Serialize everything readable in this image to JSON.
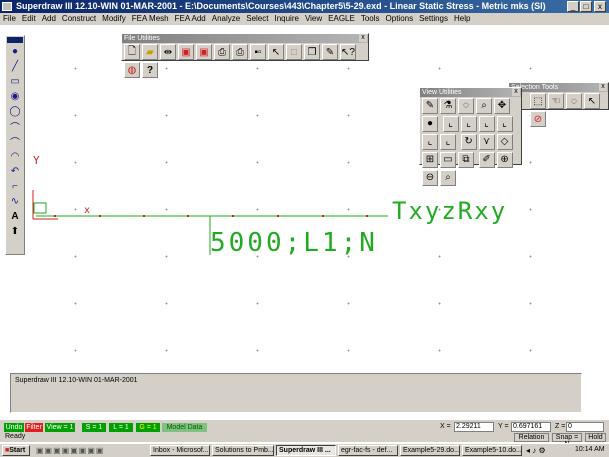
{
  "window": {
    "title": "Superdraw III 12.10-WIN 01-MAR-2001 - E:\\Documents\\Courses\\443\\Chapter5\\5-29.exd - Linear Static Stress - Metric mks (SI)",
    "minimize": "_",
    "maximize": "□",
    "close": "x"
  },
  "menu": [
    "File",
    "Edit",
    "Add",
    "Construct",
    "Modify",
    "FEA Mesh",
    "FEA Add",
    "Analyze",
    "Select",
    "Inquire",
    "View",
    "EAGLE",
    "Tools",
    "Options",
    "Settings",
    "Help"
  ],
  "palettes": {
    "file_utilities": {
      "title": "File Utilities",
      "close": "x",
      "icons": [
        "new-icon",
        "open-icon",
        "merge-icon",
        "save-icon",
        "save-as-icon",
        "print-icon",
        "plot-icon",
        "pointer-icon",
        "blank-icon",
        "copy-icon",
        "pen-icon",
        "help-select-icon",
        "snapshot-icon",
        "help-icon"
      ]
    },
    "view_utilities": {
      "title": "View Utilities",
      "close": "x",
      "icons": [
        "pen-icon",
        "flask-icon",
        "dash-circle-icon",
        "zoom-icon",
        "pan-icon",
        "sphere-icon",
        "view-xy-icon",
        "view-yz-icon",
        "view-xz-icon",
        "view-iso-icon",
        "view-top-icon",
        "view-side-icon",
        "rotate-icon",
        "axis-icon",
        "perspective-icon",
        "dynamic-icon",
        "fit-icon",
        "cube-icon",
        "pencil-icon",
        "zoom-in-icon",
        "zoom-out-icon",
        "zoom-window-icon"
      ]
    },
    "selection_tools": {
      "title": "Selection Tools",
      "close": "x",
      "icons": [
        "select-box-icon",
        "select-hand-icon",
        "select-lasso-icon",
        "select-pointer-icon",
        "deselect-icon"
      ]
    }
  },
  "canvas": {
    "axis_label": "Y",
    "right_label": "TxyzRxy",
    "load_label": "5000;L1;N",
    "x_marker": "x"
  },
  "command_area": {
    "text": "Superdraw III 12.10-WIN 01-MAR-2001"
  },
  "status": {
    "buttons": [
      "Undo",
      "Filter",
      "View = 1",
      "S = 1",
      "L = 1",
      "G = 1",
      "Model Data"
    ],
    "button_colors": [
      "#00a000",
      "#e02020",
      "#00a000",
      "#00a000",
      "#00a000",
      "#00a000",
      "#00a000"
    ],
    "x_label": "X =",
    "x_value": "2.29211",
    "y_label": "Y =",
    "y_value": "0.697161",
    "z_label": "Z =",
    "z_value": "0",
    "ready": "Ready",
    "relation": "Relation",
    "snap": "Snap = N",
    "hold": "Hold"
  },
  "taskbar": {
    "start": "Start",
    "tasks": [
      "Inbox - Microsof...",
      "Solutions to Pmb...",
      "Superdraw III ...",
      "egr-fac-fs - def...",
      "Example5-29.do...",
      "Example5-10.do..."
    ],
    "time": "10:14 AM"
  },
  "colors": {
    "model_green": "#22aa22",
    "node_red": "#cc2222",
    "titlebar": "#0a246a"
  }
}
